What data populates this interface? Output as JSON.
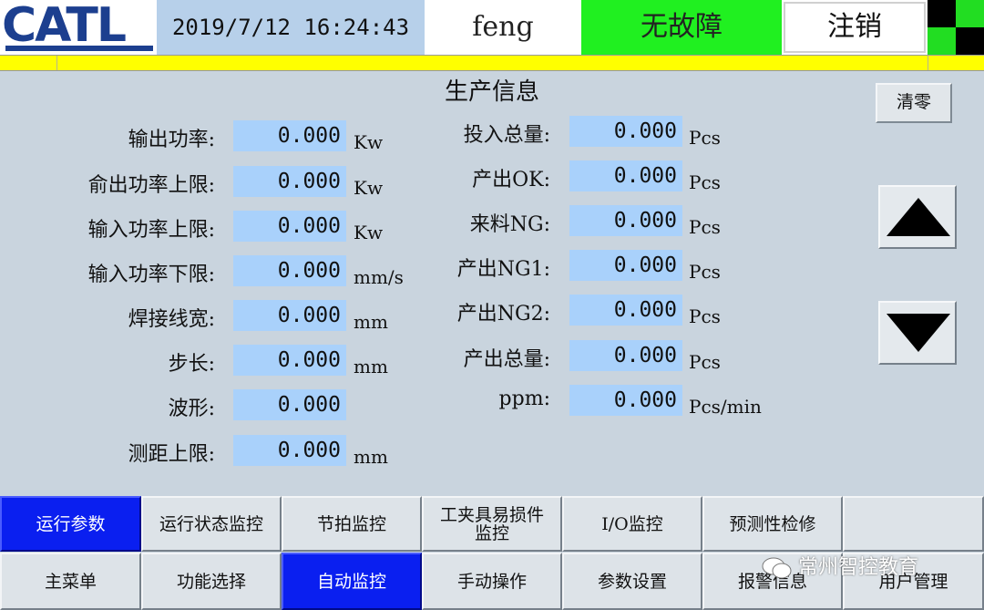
{
  "header": {
    "logo": "CATL",
    "datetime": "2019/7/12  16:24:43",
    "user": "feng",
    "fault_status": "无故障",
    "logout_label": "注销",
    "fault_color": "#20f020"
  },
  "main": {
    "title": "生产信息",
    "clear_label": "清零",
    "left_fields": [
      {
        "label": "输出功率:",
        "value": "0.000",
        "unit": "Kw"
      },
      {
        "label": "俞出功率上限:",
        "value": "0.000",
        "unit": "Kw"
      },
      {
        "label": "输入功率上限:",
        "value": "0.000",
        "unit": "Kw"
      },
      {
        "label": "输入功率下限:",
        "value": "0.000",
        "unit": "mm/s"
      },
      {
        "label": "焊接线宽:",
        "value": "0.000",
        "unit": "mm"
      },
      {
        "label": "步长:",
        "value": "0.000",
        "unit": "mm"
      },
      {
        "label": "波形:",
        "value": "0.000",
        "unit": ""
      },
      {
        "label": "测距上限:",
        "value": "0.000",
        "unit": "mm"
      }
    ],
    "right_fields": [
      {
        "label": "投入总量:",
        "value": "0.000",
        "unit": "Pcs"
      },
      {
        "label": "产出OK:",
        "value": "0.000",
        "unit": "Pcs"
      },
      {
        "label": "来料NG:",
        "value": "0.000",
        "unit": "Pcs"
      },
      {
        "label": "产出NG1:",
        "value": "0.000",
        "unit": "Pcs"
      },
      {
        "label": "产出NG2:",
        "value": "0.000",
        "unit": "Pcs"
      },
      {
        "label": "产出总量:",
        "value": "0.000",
        "unit": "Pcs"
      },
      {
        "label": "ppm:",
        "value": "0.000",
        "unit": "Pcs/min"
      }
    ],
    "up_icon": "triangle-up-icon",
    "down_icon": "triangle-down-icon"
  },
  "tabs_row1": [
    {
      "label": "运行参数",
      "active": true
    },
    {
      "label": "运行状态监控",
      "active": false
    },
    {
      "label": "节拍监控",
      "active": false
    },
    {
      "label": "工夹具易损件\n监控",
      "active": false
    },
    {
      "label": "I/O监控",
      "active": false
    },
    {
      "label": "预测性检修",
      "active": false
    },
    {
      "label": "",
      "active": false
    }
  ],
  "tabs_row2": [
    {
      "label": "主菜单",
      "active": false
    },
    {
      "label": "功能选择",
      "active": false
    },
    {
      "label": "自动监控",
      "active": true
    },
    {
      "label": "手动操作",
      "active": false
    },
    {
      "label": "参数设置",
      "active": false
    },
    {
      "label": "报警信息",
      "active": false
    },
    {
      "label": "用户管理",
      "active": false
    }
  ],
  "watermark": "常州智控教育",
  "colors": {
    "accent_blue": "#0a1ff0",
    "field_blue": "#a9d1fb",
    "yellow_bar": "#ffff00"
  }
}
